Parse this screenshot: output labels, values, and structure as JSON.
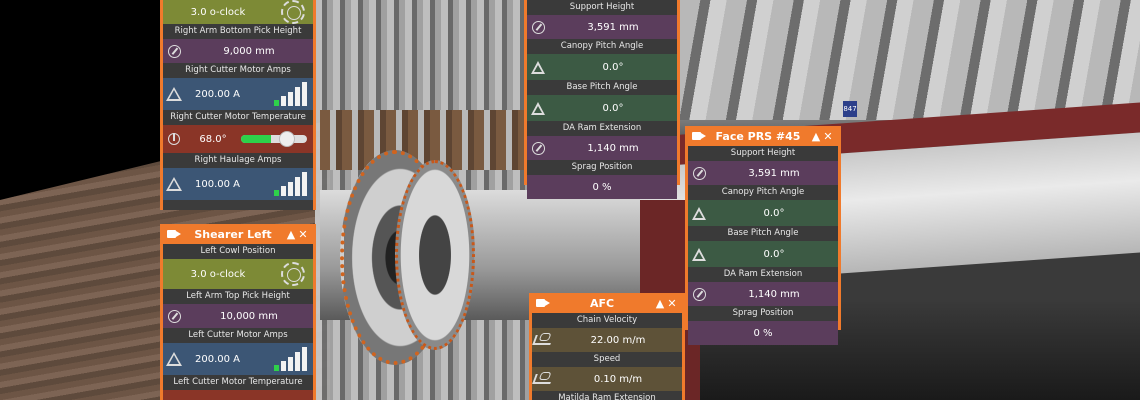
{
  "scene": {
    "face_badge": "847"
  },
  "shearer_right": {
    "rows": [
      {
        "label": "",
        "value": "3.0 o-clock",
        "icon": "dial-icon"
      },
      {
        "label": "Right Arm Bottom Pick Height",
        "value": "9,000 mm",
        "icon": "gauge-icon"
      },
      {
        "label": "Right Cutter Motor Amps",
        "value": "200.00 A",
        "icon": "warning-icon",
        "level_bars_on": 1,
        "level_bars_total": 5
      },
      {
        "label": "Right Cutter Motor Temperature",
        "value": "68.0°",
        "icon": "thermometer-icon",
        "level_percent": 45
      },
      {
        "label": "Right Haulage Amps",
        "value": "100.00 A",
        "icon": "warning-icon",
        "level_bars_on": 1,
        "level_bars_total": 5
      }
    ]
  },
  "shearer_left": {
    "title": "Shearer Left",
    "rows": [
      {
        "label": "Left Cowl Position",
        "value": "3.0 o-clock"
      },
      {
        "label": "Left Arm Top Pick Height",
        "value": "10,000 mm"
      },
      {
        "label": "Left Cutter Motor Amps",
        "value": "200.00 A",
        "level_bars_on": 1,
        "level_bars_total": 5
      },
      {
        "label": "Left Cutter Motor Temperature",
        "value": ""
      }
    ]
  },
  "prs_top": {
    "rows": [
      {
        "label": "Support Height",
        "value": "3,591 mm"
      },
      {
        "label": "Canopy Pitch Angle",
        "value": "0.0°"
      },
      {
        "label": "Base Pitch Angle",
        "value": "0.0°"
      },
      {
        "label": "DA Ram Extension",
        "value": "1,140 mm"
      },
      {
        "label": "Sprag Position",
        "value": "0 %"
      }
    ]
  },
  "prs_45": {
    "title": "Face PRS #45",
    "rows": [
      {
        "label": "Support Height",
        "value": "3,591 mm"
      },
      {
        "label": "Canopy Pitch Angle",
        "value": "0.0°"
      },
      {
        "label": "Base Pitch Angle",
        "value": "0.0°"
      },
      {
        "label": "DA Ram Extension",
        "value": "1,140 mm"
      },
      {
        "label": "Sprag Position",
        "value": "0 %"
      }
    ]
  },
  "afc": {
    "title": "AFC",
    "rows": [
      {
        "label": "Chain Velocity",
        "value": "22.00 m/m"
      },
      {
        "label": "Speed",
        "value": "0.10 m/m"
      },
      {
        "label": "Matilda Ram Extension",
        "value": ""
      }
    ]
  },
  "controls": {
    "collapse": "▲",
    "close": "✕"
  },
  "colors": {
    "accent": "#f07a2c",
    "indicator_on": "#2ed14a"
  }
}
